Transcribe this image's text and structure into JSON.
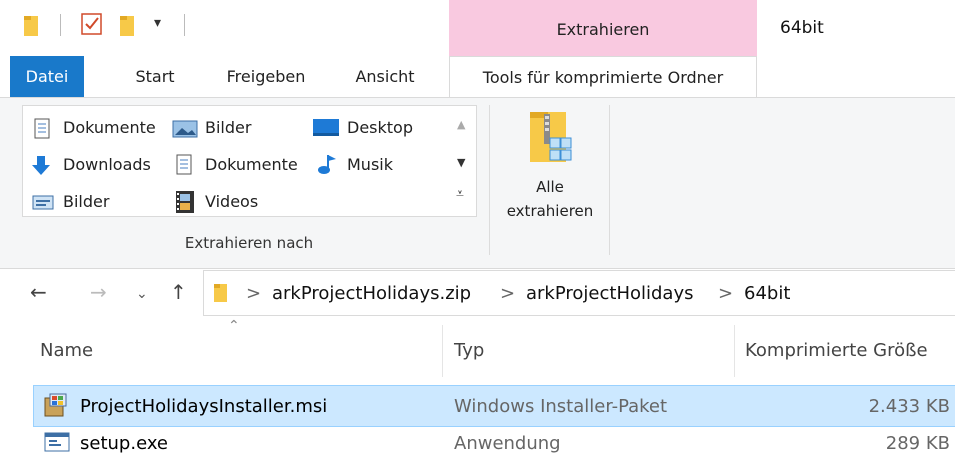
{
  "window": {
    "title": "64bit"
  },
  "context_tab": {
    "label": "Extrahieren"
  },
  "tabs": [
    {
      "label": "Datei"
    },
    {
      "label": "Start"
    },
    {
      "label": "Freigeben"
    },
    {
      "label": "Ansicht"
    },
    {
      "label": "Tools für komprimierte Ordner"
    }
  ],
  "ribbon": {
    "gallery": [
      {
        "label": "Dokumente",
        "icon": "documents-icon"
      },
      {
        "label": "Bilder",
        "icon": "pictures-icon"
      },
      {
        "label": "Desktop",
        "icon": "desktop-icon"
      },
      {
        "label": "Downloads",
        "icon": "downloads-icon"
      },
      {
        "label": "Dokumente",
        "icon": "documents-icon"
      },
      {
        "label": "Musik",
        "icon": "music-icon"
      },
      {
        "label": "Bilder",
        "icon": "pictures-icon"
      },
      {
        "label": "Videos",
        "icon": "videos-icon"
      }
    ],
    "group_label": "Extrahieren nach",
    "extract_all_line1": "Alle",
    "extract_all_line2": "extrahieren"
  },
  "address": {
    "crumbs": [
      "arkProjectHolidays.zip",
      "arkProjectHolidays",
      "64bit"
    ],
    "separator": ">"
  },
  "columns": {
    "name": "Name",
    "type": "Typ",
    "size": "Komprimierte Größe"
  },
  "files": [
    {
      "name": "ProjectHolidaysInstaller.msi",
      "type": "Windows Installer-Paket",
      "size": "2.433 KB",
      "selected": true
    },
    {
      "name": "setup.exe",
      "type": "Anwendung",
      "size": "289 KB",
      "selected": false
    }
  ],
  "colors": {
    "file_tab": "#1979ca",
    "context": "#f9c9e0",
    "selection": "#cce8ff"
  }
}
